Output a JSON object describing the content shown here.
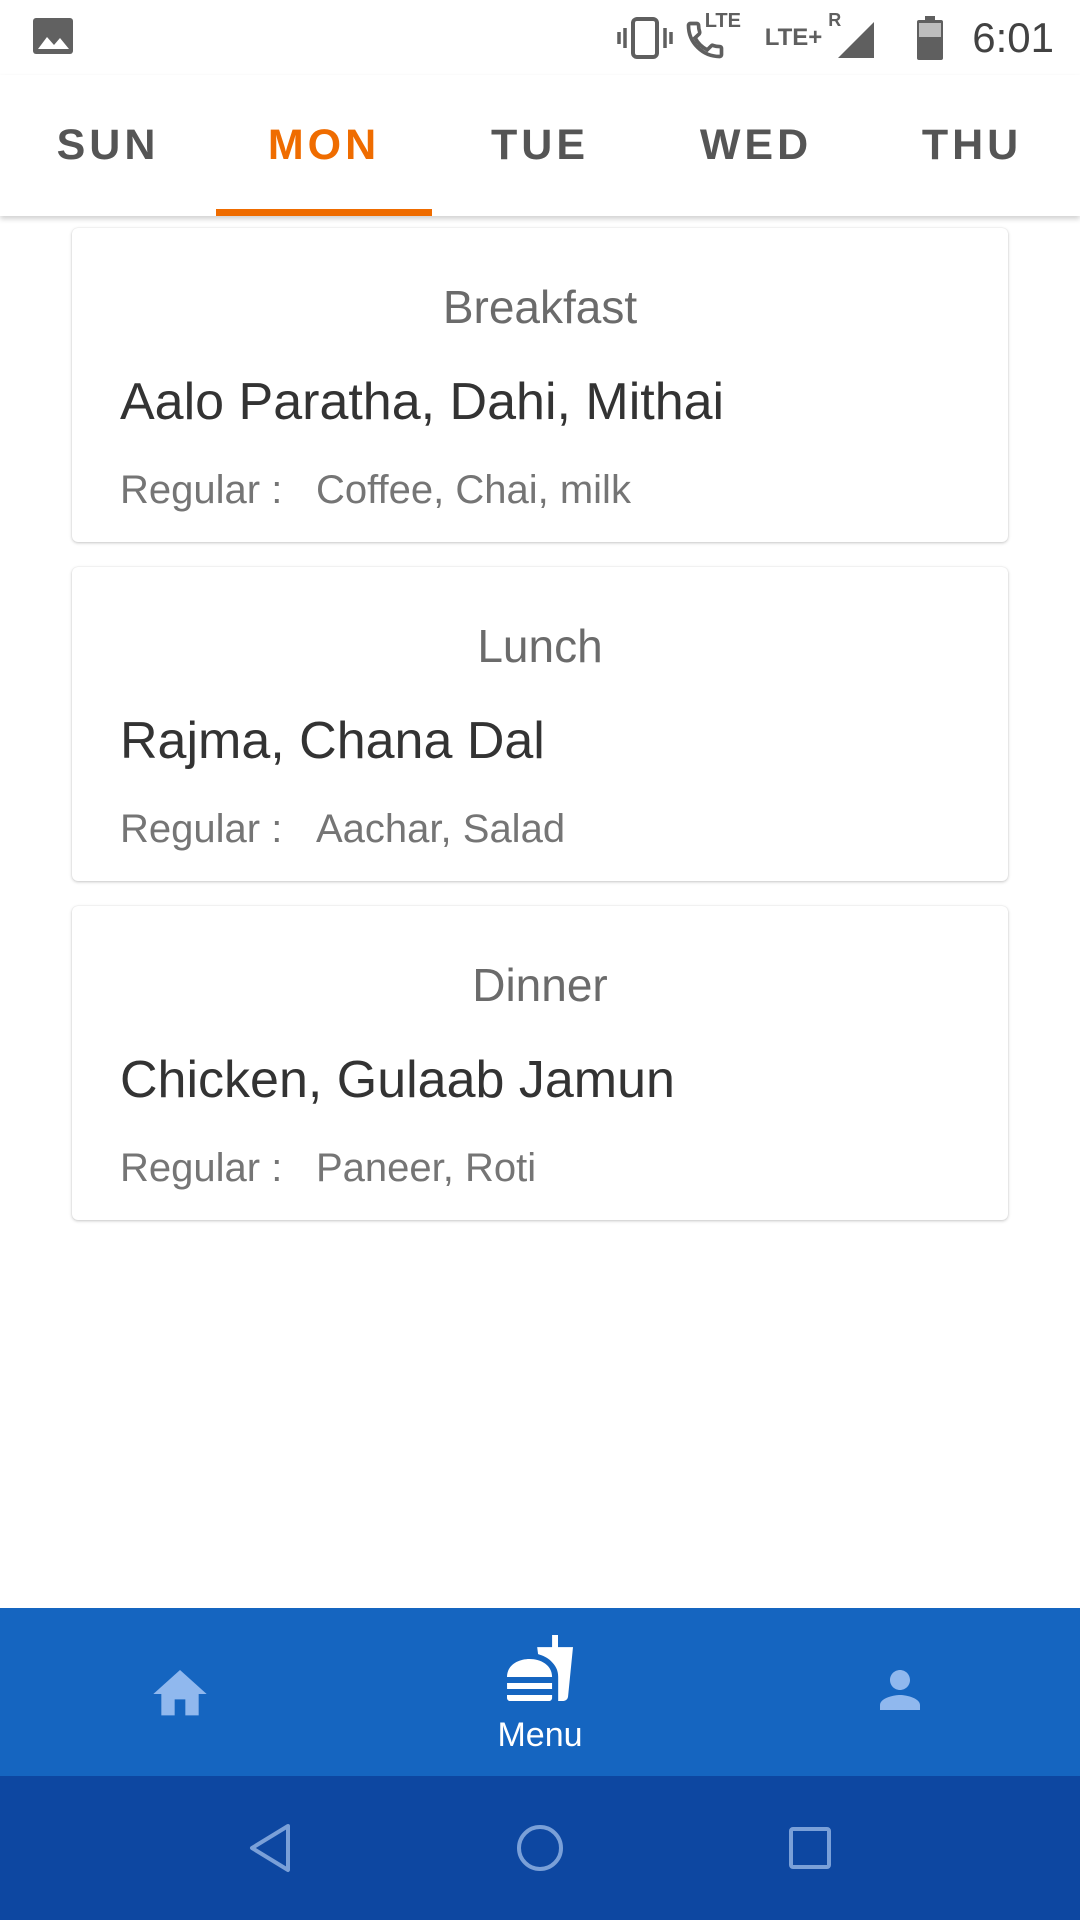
{
  "status_bar": {
    "time": "6:01",
    "lte1": "LTE",
    "lte2": "LTE+",
    "roaming": "R",
    "icons": [
      "image-icon",
      "vibrate-icon",
      "volte-call-icon",
      "signal-icon",
      "battery-icon"
    ]
  },
  "tabs": [
    {
      "label": "SUN",
      "active": false
    },
    {
      "label": "MON",
      "active": true
    },
    {
      "label": "TUE",
      "active": false
    },
    {
      "label": "WED",
      "active": false
    },
    {
      "label": "THU",
      "active": false
    }
  ],
  "meals": [
    {
      "title": "Breakfast",
      "items": "Aalo Paratha, Dahi, Mithai",
      "regular_label": "Regular :",
      "regular_value": "Coffee, Chai, milk"
    },
    {
      "title": "Lunch",
      "items": "Rajma, Chana Dal",
      "regular_label": "Regular :",
      "regular_value": "Aachar, Salad"
    },
    {
      "title": "Dinner",
      "items": "Chicken, Gulaab Jamun",
      "regular_label": "Regular :",
      "regular_value": "Paneer, Roti"
    }
  ],
  "bottom_nav": {
    "items": [
      {
        "icon": "home-icon",
        "label": ""
      },
      {
        "icon": "fastfood-icon",
        "label": "Menu"
      },
      {
        "icon": "person-icon",
        "label": ""
      }
    ],
    "active_index": 1
  },
  "system_nav": [
    "back-icon",
    "home-circle-icon",
    "recents-icon"
  ],
  "colors": {
    "accent": "#ef6c00",
    "nav_bar": "#1565c0",
    "system_nav": "#0d47a1",
    "inactive_nav_icon": "#90b8ee"
  }
}
